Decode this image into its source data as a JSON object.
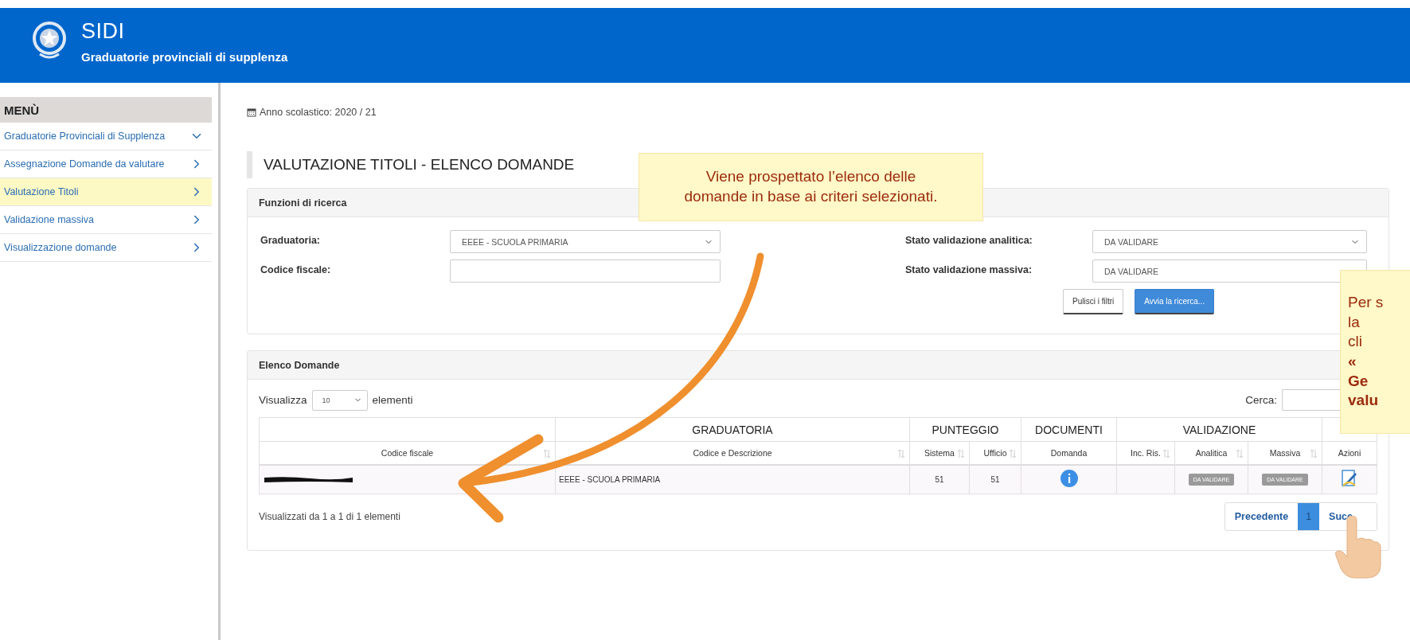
{
  "header": {
    "title": "SIDI",
    "subtitle": "Graduatorie provinciali di supplenza"
  },
  "sidebar": {
    "heading": "MENÙ",
    "items": [
      {
        "label": "Graduatorie Provinciali di Supplenza",
        "kind": "group",
        "selected": false
      },
      {
        "label": "Assegnazione Domande da valutare",
        "kind": "link",
        "selected": false
      },
      {
        "label": "Valutazione Titoli",
        "kind": "link",
        "selected": true
      },
      {
        "label": "Validazione massiva",
        "kind": "link",
        "selected": false
      },
      {
        "label": "Visualizzazione domande",
        "kind": "link",
        "selected": false
      }
    ]
  },
  "academic_year": "Anno scolastico: 2020 / 21",
  "page_title": "VALUTAZIONE TITOLI - ELENCO DOMANDE",
  "search_panel": {
    "title": "Funzioni di ricerca",
    "fields": [
      {
        "label": "Graduatoria:",
        "kind": "select",
        "value": "EEEE - SCUOLA PRIMARIA"
      },
      {
        "label": "Stato validazione analitica:",
        "kind": "select",
        "value": "DA VALIDARE"
      },
      {
        "label": "Codice fiscale:",
        "kind": "input"
      },
      {
        "label": "Stato validazione massiva:",
        "kind": "input",
        "value": "DA VALIDARE"
      }
    ],
    "buttons": [
      {
        "label": "Pulisci i filtri",
        "kind": "default"
      },
      {
        "label": "Avvia la ricerca...",
        "kind": "primary"
      }
    ]
  },
  "results_panel": {
    "title": "Elenco Domande",
    "show_before": "Visualizza",
    "page_size": "10",
    "show_after": "elementi",
    "search_label": "Cerca:",
    "table": {
      "header_groups": [
        {
          "columns": [
            {
              "label": "Codice fiscale",
              "sortable": true
            }
          ]
        },
        {
          "label": "GRADUATORIA",
          "columns": [
            {
              "label": "Codice e Descrizione",
              "sortable": true
            }
          ]
        },
        {
          "label": "PUNTEGGIO",
          "columns": [
            {
              "label": "Sistema",
              "sortable": true
            },
            {
              "label": "Ufficio",
              "sortable": true
            }
          ]
        },
        {
          "label": "DOCUMENTI",
          "columns": [
            {
              "label": "Domanda",
              "sortable": false
            }
          ]
        },
        {
          "label": "VALIDAZIONE",
          "columns": [
            {
              "label": "Inc. Ris.",
              "sortable": true
            },
            {
              "label": "Analitica",
              "sortable": true
            },
            {
              "label": "Massiva",
              "sortable": true
            }
          ]
        },
        {
          "columns": [
            {
              "label": "Azioni",
              "sortable": false
            }
          ]
        }
      ],
      "rows": [
        {
          "cells": [
            {
              "kind": "redacted"
            },
            {
              "kind": "text",
              "text": "EEEE - SCUOLA PRIMARIA"
            },
            {
              "kind": "number",
              "text": "51"
            },
            {
              "kind": "number",
              "text": "51"
            },
            {
              "kind": "info"
            },
            {
              "kind": "empty"
            },
            {
              "kind": "badge",
              "text": "DA VALIDARE"
            },
            {
              "kind": "badge",
              "text": "DA VALIDARE"
            },
            {
              "kind": "edit"
            }
          ]
        }
      ]
    },
    "info": "Visualizzati da 1 a 1 di 1 elementi",
    "pagination": {
      "previous": "Precedente",
      "pages": [
        {
          "label": "1",
          "selected": true
        }
      ],
      "next": "Succ"
    }
  },
  "callouts": [
    {
      "lines": [
        {
          "text": "Viene prospettato l’elenco delle",
          "bold": false
        },
        {
          "text": "domande in base ai criteri selezionati.",
          "bold": false
        }
      ]
    },
    {
      "lines": [
        {
          "text": "Per s",
          "bold": false
        },
        {
          "text": "la",
          "bold": false
        },
        {
          "text": "cli",
          "bold": false
        },
        {
          "text": "«",
          "bold": true
        },
        {
          "text": "Ge",
          "bold": true
        },
        {
          "text": "valu",
          "bold": true
        }
      ]
    }
  ]
}
